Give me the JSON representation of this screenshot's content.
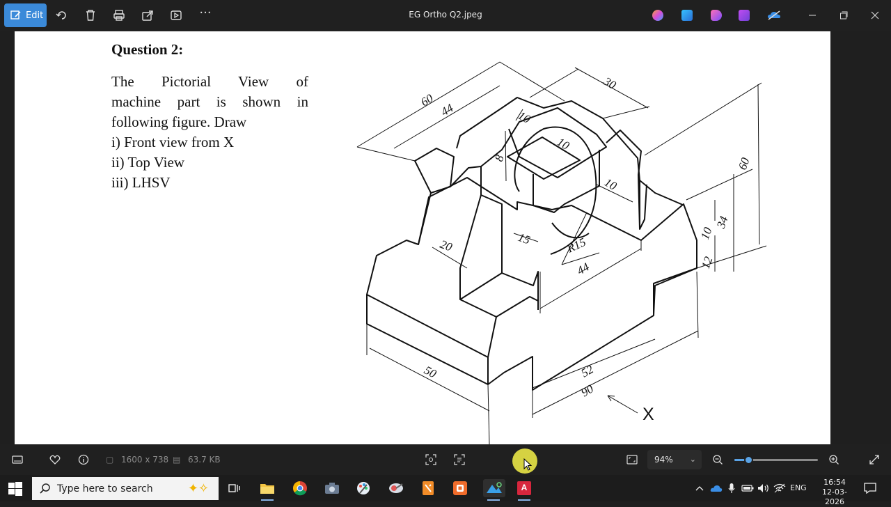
{
  "toolbar": {
    "edit_label": "Edit",
    "title": "EG Ortho Q2.jpeg",
    "icons": [
      "rotate-icon",
      "delete-icon",
      "print-icon",
      "share-icon",
      "slideshow-icon",
      "more-icon"
    ],
    "app_icons": [
      "copilot-icon",
      "paint-icon",
      "clipchamp-icon",
      "designer-icon",
      "onedrive-icon"
    ],
    "window_controls": [
      "minimize-icon",
      "restore-icon",
      "close-icon"
    ]
  },
  "document": {
    "question_title": "Question 2:",
    "body_line_1_words": [
      "The",
      "Pictorial",
      "View",
      "of"
    ],
    "body_line_2_words": [
      "machine",
      "part",
      "is",
      "shown",
      "in"
    ],
    "body_line_3": "following figure. Draw",
    "tasks": [
      "i) Front view from X",
      "ii) Top View",
      "iii) LHSV"
    ],
    "dimensions": [
      "60",
      "44",
      "30",
      "10",
      "10",
      "8",
      "10",
      "60",
      "34",
      "10",
      "12",
      "20",
      "15",
      "R15",
      "44",
      "50",
      "52",
      "90",
      "X"
    ]
  },
  "statusbar": {
    "dimensions": "1600 x 738",
    "file_size": "63.7 KB",
    "zoom_label": "94%",
    "zoom_fraction": 0.17
  },
  "taskbar": {
    "search_placeholder": "Type here to search",
    "language": "ENG",
    "time": "16:54",
    "date": "12-03-2026"
  },
  "colors": {
    "accent": "#3b8ad9",
    "cursor_highlight": "#e9e646"
  }
}
